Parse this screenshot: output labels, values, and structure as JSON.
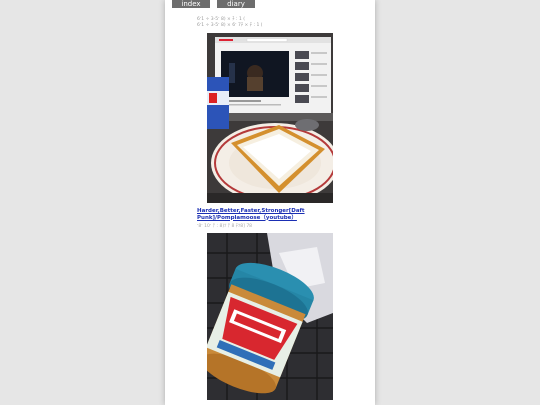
{
  "nav": {
    "index_label": "index",
    "diary_index_label": "diary index"
  },
  "entry": {
    "meta_line1": "6ʼ1 ÷ 3-5ʼ 8) × ﾁ︰1 (",
    "meta_line2": "6ʼ1 ÷ 3-5ʼ 8) × 6ʼ 7ﾁ × ﾁ︰1 (",
    "link_text": "Harder,Better,Faster,Stronger[Daft Punk]/Pomplamoose（youtube）",
    "caption": "ʼ8ʼ 10ʼ ﾃ︰8)ﾂ ﾃ 8 ﾁﾂ8] 78"
  },
  "photos": [
    {
      "name": "toast-with-laptop-photo"
    },
    {
      "name": "skippy-jar-photo"
    }
  ],
  "colors": {
    "link": "#1a2eb3",
    "nav_button": "#6d6d6d",
    "background": "#e6e6e6"
  }
}
